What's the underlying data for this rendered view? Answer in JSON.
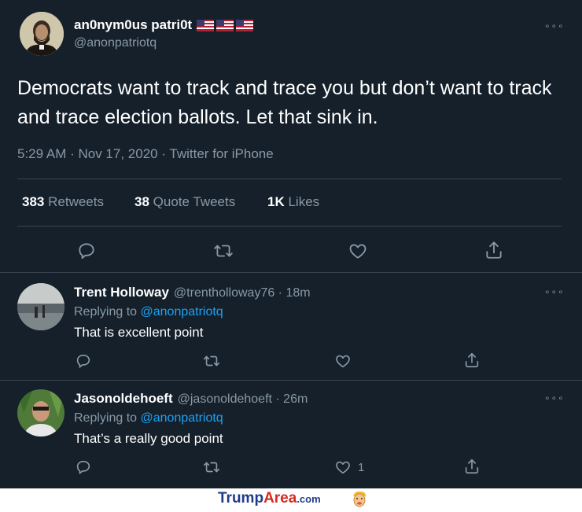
{
  "main_tweet": {
    "display_name": "an0nym0us patri0t",
    "handle": "@anonpatriotq",
    "text": "Democrats want to track and trace you but don’t want to track and trace election ballots. Let that sink in.",
    "timestamp": "5:29 AM · Nov 17, 2020 · Twitter for iPhone",
    "stats": {
      "retweets_count": "383",
      "retweets_label": "Retweets",
      "quotes_count": "38",
      "quotes_label": "Quote Tweets",
      "likes_count": "1K",
      "likes_label": "Likes"
    },
    "more": "∘∘∘"
  },
  "replies": [
    {
      "display_name": "Trent Holloway",
      "meta": "@trentholloway76 · 18m",
      "replying_prefix": "Replying to",
      "replying_to": "@anonpatriotq",
      "text": "That is excellent point",
      "like_count": ""
    },
    {
      "display_name": "Jasonoldehoeft",
      "meta": "@jasonoldehoeft · 26m",
      "replying_prefix": "Replying to",
      "replying_to": "@anonpatriotq",
      "text": "That’s a really good point",
      "like_count": "1"
    }
  ],
  "footer": {
    "brand_part1": "Trump",
    "brand_part2": "Area",
    "brand_suffix": ".com"
  },
  "colors": {
    "background": "#15202b",
    "muted": "#8899a6",
    "link": "#1da1f2",
    "brand_blue": "#1f3c8c",
    "brand_red": "#d52b1e"
  },
  "icons": [
    "reply-icon",
    "retweet-icon",
    "like-icon",
    "share-icon",
    "more-icon",
    "us-flag-icon",
    "logo-face-icon"
  ]
}
